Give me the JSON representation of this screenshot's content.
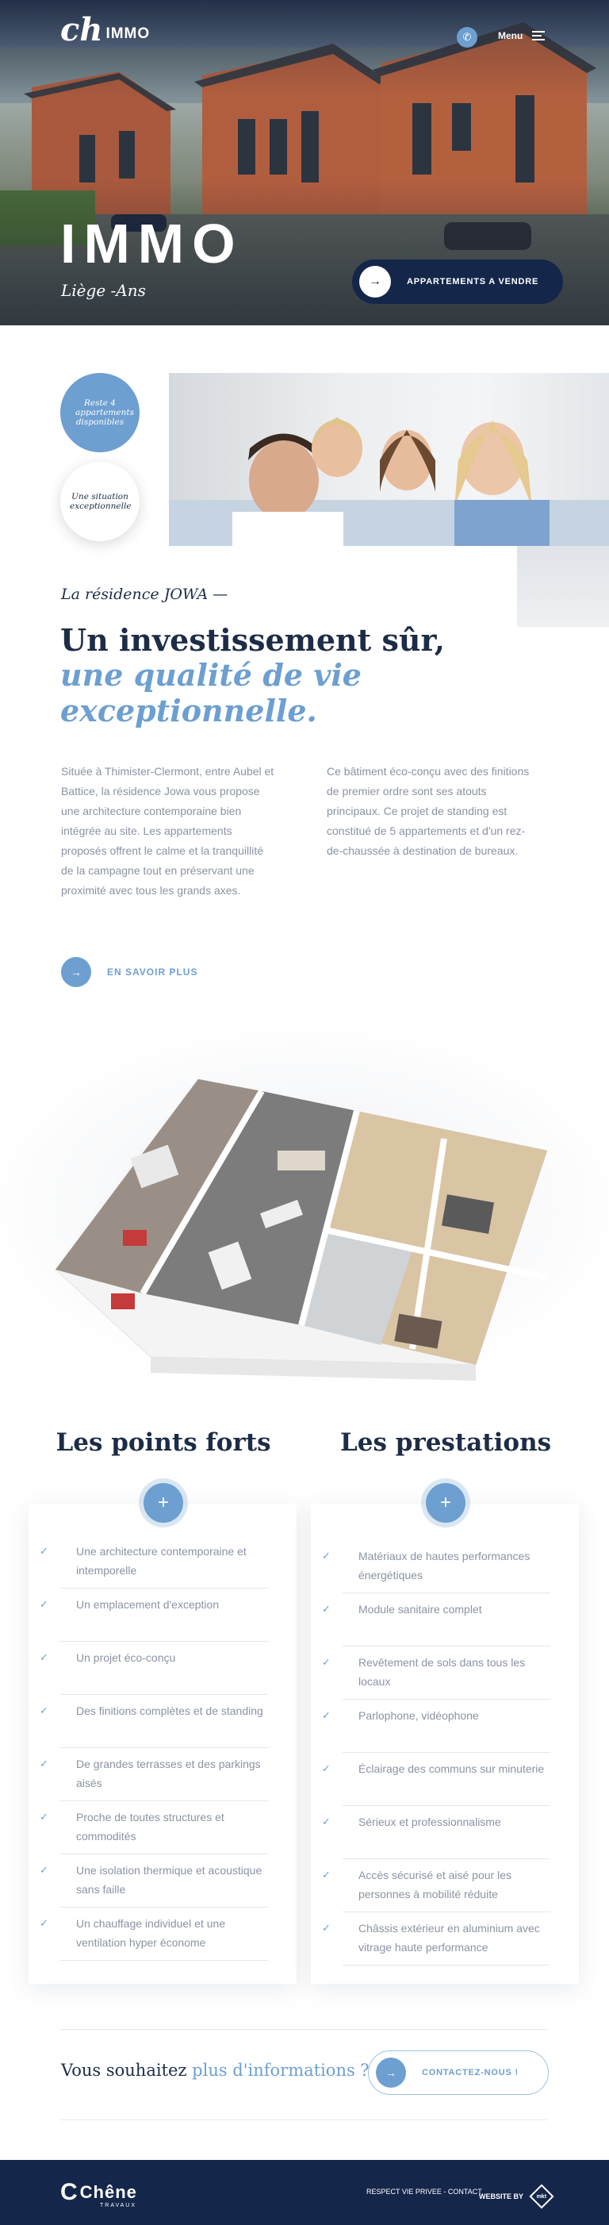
{
  "header": {
    "logo_mark": "ch",
    "logo_word": "IMMO",
    "menu_label": "Menu"
  },
  "hero": {
    "title": "IMMO",
    "subtitle": "Liège -Ans",
    "cta_label": "APPARTEMENTS A VENDRE"
  },
  "intro": {
    "badge_available": "Reste 4 appartements disponibles",
    "badge_location": "Une situation exceptionnelle",
    "kicker": "La résidence JOWA —",
    "heading_line1": "Un investissement sûr,",
    "heading_line2": "une qualité de vie exceptionnelle.",
    "paragraph_left": "Située à Thimister-Clermont, entre Aubel et Battice, la résidence Jowa vous propose une architecture contemporaine bien intégrée au site. Les appartements proposés offrent le calme et la tranquillité de la campagne tout en préservant une proximité avec tous les grands axes.",
    "paragraph_right": "Ce bâtiment éco-conçu avec des finitions de premier ordre sont ses atouts principaux. Ce projet de standing est constitué de 5 appartements et d'un rez-de-chaussée à destination de bureaux.",
    "learn_more": "EN SAVOIR PLUS"
  },
  "strengths": {
    "title": "Les points forts",
    "items": [
      "Une architecture contemporaine et intemporelle",
      "Un emplacement d'exception",
      "Un projet éco-conçu",
      "Des finitions complètes et de standing",
      "De grandes terrasses et des parkings aisés",
      "Proche de toutes structures et commodités",
      "Une isolation thermique et acoustique sans faille",
      "Un chauffage individuel et une ventilation hyper économe"
    ]
  },
  "services": {
    "title": "Les prestations",
    "items": [
      "Matériaux de hautes performances énergétiques",
      "Module sanitaire complet",
      "Revêtement de sols dans tous les locaux",
      "Parlophone, vidéophone",
      "Éclairage des communs sur minuterie",
      "Sérieux et professionnalisme",
      "Accès sécurisé et aisé pour les personnes à mobilité réduite",
      "Châssis extérieur en aluminium avec vitrage haute performance"
    ]
  },
  "contact": {
    "question_start": "Vous souhaitez ",
    "question_highlight": "plus d'informations ?",
    "cta_label": "CONTACTEZ-NOUS !"
  },
  "footer": {
    "brand": "Chêne",
    "brand_tag": "TRAVAUX",
    "links": "RESPECT VIE PRIVEE - CONTACT",
    "website_by": "WEBSITE BY",
    "agency_mark": "mkt"
  },
  "colors": {
    "navy": "#14264a",
    "accent_blue": "#6d9fd0",
    "text_grey": "#8b93a3"
  }
}
